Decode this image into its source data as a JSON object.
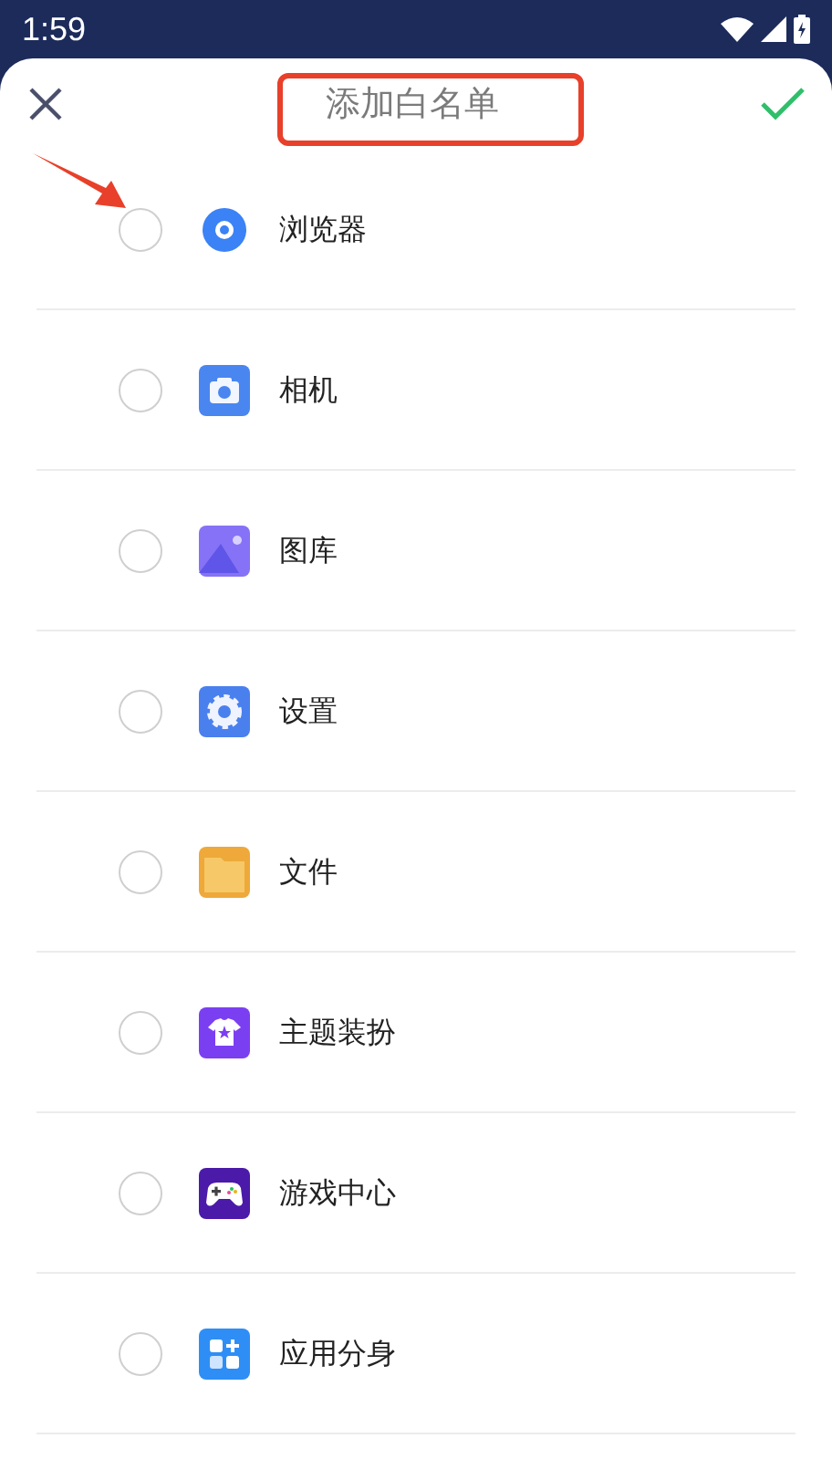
{
  "status_bar": {
    "time": "1:59"
  },
  "header": {
    "title": "添加白名单"
  },
  "apps": [
    {
      "name": "浏览器",
      "kind": "browser",
      "selected": false
    },
    {
      "name": "相机",
      "kind": "camera",
      "selected": false
    },
    {
      "name": "图库",
      "kind": "gallery",
      "selected": false
    },
    {
      "name": "设置",
      "kind": "settings",
      "selected": false
    },
    {
      "name": "文件",
      "kind": "files",
      "selected": false
    },
    {
      "name": "主题装扮",
      "kind": "theme",
      "selected": false
    },
    {
      "name": "游戏中心",
      "kind": "game",
      "selected": false
    },
    {
      "name": "应用分身",
      "kind": "clone",
      "selected": false
    }
  ]
}
